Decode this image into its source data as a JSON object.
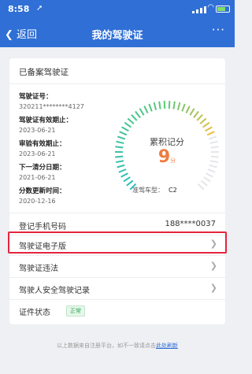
{
  "status_bar": {
    "time": "8:58",
    "location_arrow": "➚"
  },
  "nav": {
    "back_label": "返回",
    "title": "我的驾驶证",
    "more_label": "···"
  },
  "card": {
    "header": "已备案驾驶证",
    "fields": [
      {
        "label": "驾驶证号：",
        "value": "320211********4127"
      },
      {
        "label": "驾驶证有效期止：",
        "value": "2023-06-21"
      },
      {
        "label": "审验有效期止：",
        "value": "2023-06-21"
      },
      {
        "label": "下一清分日期：",
        "value": "2021-06-21"
      },
      {
        "label": "分数更新时间：",
        "value": "2020-12-16"
      }
    ],
    "gauge": {
      "label": "累积记分",
      "value": "9",
      "unit": "分",
      "score": 9,
      "max": 12
    },
    "license_type_label": "准驾车型：",
    "license_type_value": "C2",
    "phone_label": "登记手机号码",
    "phone_value": "188****0037",
    "menu": [
      {
        "label": "驾驶证电子版"
      },
      {
        "label": "驾驶证违法"
      },
      {
        "label": "驾驶人安全驾驶记录"
      }
    ],
    "cert_status_label": "证件状态",
    "cert_status_badge": "正常"
  },
  "footer": {
    "text": "以上数据来自注册平台，如不一致请点击",
    "link": "此处刷新"
  },
  "colors": {
    "brand": "#2f6fd6",
    "score": "#f07b3f",
    "highlight": "#e4253f",
    "ok": "#2ca44f"
  }
}
